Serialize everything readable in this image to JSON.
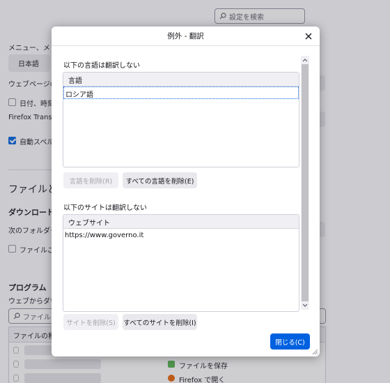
{
  "background": {
    "search_placeholder": "設定を検索",
    "menu_language_label": "メニュー、メッセー",
    "language_button": "日本語",
    "webpage_label": "ウェブページの表",
    "date_checkbox_label": "日付、時刻",
    "firefox_translate_label": "Firefox Transla",
    "spell_checkbox_label": "自動スペル",
    "files_apps_heading": "ファイルとア",
    "downloads_heading": "ダウンロード",
    "save_to_label": "次のフォルダーに",
    "per_file_checkbox_label": "ファイルごと",
    "programs_heading": "プログラム",
    "programs_desc": "ウェブからダウン",
    "file_type_search_placeholder": "ファイルの種",
    "file_type_column": "ファイルの種類",
    "action_save_file": "ファイルを保存",
    "action_open_firefox": "Firefox で開く"
  },
  "dialog": {
    "title": "例外 - 翻訳",
    "languages_section_label": "以下の言語は翻訳しない",
    "languages_column": "言語",
    "languages": [
      "ロシア語"
    ],
    "remove_language_button": "言語を削除(R)",
    "remove_all_languages_button": "すべての言語を削除(E)",
    "sites_section_label": "以下のサイトは翻訳しない",
    "sites_column": "ウェブサイト",
    "sites": [
      "https://www.governo.it"
    ],
    "remove_site_button": "サイトを削除(S)",
    "remove_all_sites_button": "すべてのサイトを削除(I)",
    "close_button": "閉じる(C)"
  },
  "colors": {
    "accent": "#0061e0",
    "overlay": "#50505a"
  }
}
